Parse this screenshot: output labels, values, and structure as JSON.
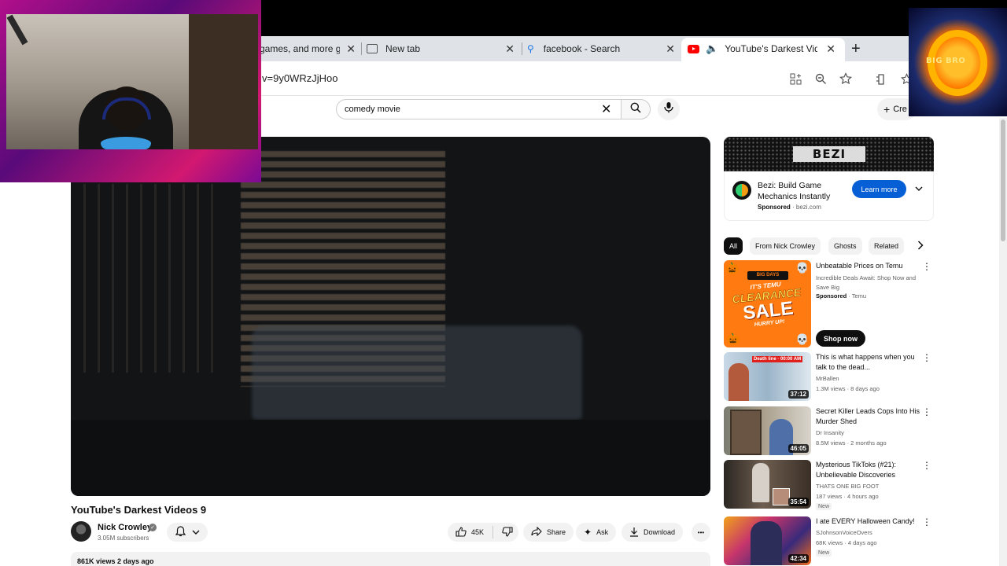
{
  "browser": {
    "tabs": [
      {
        "label": "games, and more g",
        "close": "✕"
      },
      {
        "label": "New tab",
        "close": "✕"
      },
      {
        "label": "facebook - Search",
        "close": "✕"
      },
      {
        "label": "YouTube's Darkest Vid",
        "close": "✕"
      }
    ],
    "new_tab": "+",
    "url": "v=9y0WRzJjHoo"
  },
  "masthead": {
    "search_value": "comedy movie",
    "clear": "✕",
    "create_label": "Cre"
  },
  "video": {
    "title": "YouTube's Darkest Videos 9",
    "channel": "Nick Crowley",
    "subscribers": "3.05M subscribers",
    "likes": "45K",
    "share": "Share",
    "ask": "Ask",
    "download": "Download",
    "more": "•••",
    "views_date": "861K views  2 days ago"
  },
  "ad": {
    "banner": "BEZI",
    "title": "Bezi: Build Game Mechanics Instantly",
    "sponsor_bold": "Sponsored",
    "sponsor_rest": " · bezi.com",
    "cta": "Learn more"
  },
  "chips": [
    "All",
    "From Nick Crowley",
    "Ghosts",
    "Related"
  ],
  "temu": {
    "title": "Unbeatable Prices on Temu",
    "desc": "Incredible Deals Await: Shop Now and Save Big",
    "sponsor_bold": "Sponsored",
    "sponsor_rest": " · Temu",
    "cta": "Shop now",
    "thumb_top": "BIG DAYS",
    "thumb_line1": "IT'S TEMU",
    "thumb_line2": "CLEARANCE",
    "thumb_line3": "SALE",
    "thumb_line4": "HURRY UP!"
  },
  "recs": [
    {
      "title": "This is what happens when you talk to the dead...",
      "channel": "MrBallen",
      "meta": "1.3M views · 8 days ago",
      "duration": "37:12",
      "badge": "",
      "thumb_caption": "Death line · 00:00 AM"
    },
    {
      "title": "Secret Killer Leads Cops Into His Murder Shed",
      "channel": "Dr Insanity",
      "meta": "8.5M views · 2 months ago",
      "duration": "46:05",
      "badge": ""
    },
    {
      "title": "Mysterious TikToks (#21): Unbelievable Discoveries",
      "channel": "THATS ONE BIG FOOT",
      "meta": "187 views · 4 hours ago",
      "duration": "35:54",
      "badge": "New"
    },
    {
      "title": "I ate EVERY Halloween Candy!",
      "channel": "SJohnsonVoiceOvers",
      "meta": "68K views · 4 days ago",
      "duration": "42:34",
      "badge": "New"
    }
  ],
  "overlay": {
    "logo_text": "BIG BRO"
  },
  "colors": {
    "accent": "#065fd4",
    "youtube_red": "#ff0000",
    "temu_orange": "#ff7a10"
  }
}
